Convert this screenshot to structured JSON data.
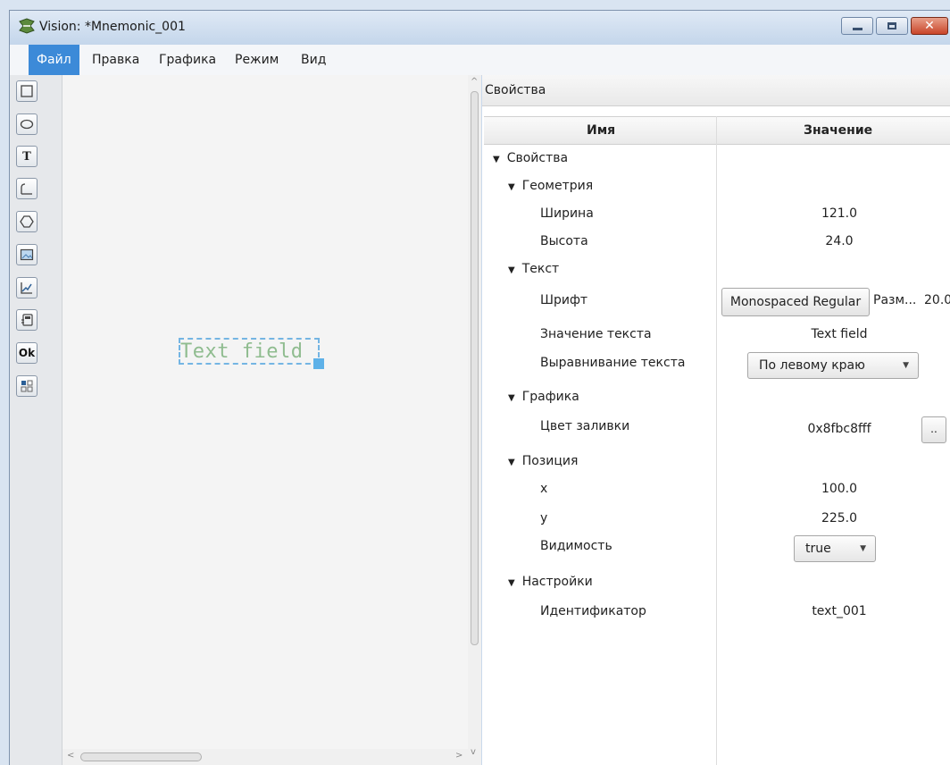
{
  "window": {
    "title": "Vision: *Mnemonic_001",
    "controls": [
      "minimize-icon",
      "maximize-icon",
      "close-icon"
    ]
  },
  "menu": {
    "items": [
      {
        "label": "Файл",
        "active": true
      },
      {
        "label": "Правка",
        "active": false
      },
      {
        "label": "Графика",
        "active": false
      },
      {
        "label": "Режим",
        "active": false
      },
      {
        "label": "Вид",
        "active": false
      }
    ]
  },
  "toolbar": {
    "tools": [
      "rectangle-icon",
      "ellipse-icon",
      "text-icon",
      "polyline-icon",
      "polygon-icon",
      "image-icon",
      "chart-icon",
      "gauge-icon",
      "button-icon",
      "grid-icon"
    ],
    "text_tool_glyph": "T",
    "button_tool_glyph": "Ok"
  },
  "canvas": {
    "text_element": "Text field",
    "text_color": "#8fbc8f",
    "selection_color": "#74b5e3"
  },
  "properties": {
    "panel_title": "Свойства",
    "col_name": "Имя",
    "col_value": "Значение",
    "root": "Свойства",
    "geometry": "Геометрия",
    "width_label": "Ширина",
    "width_value": "121.0",
    "height_label": "Высота",
    "height_value": "24.0",
    "text_group": "Текст",
    "font_label": "Шрифт",
    "font_value": "Monospaced Regular",
    "font_size_label": "Разм...",
    "font_size_value": "20.0",
    "text_value_label": "Значение текста",
    "text_value": "Text field",
    "align_label": "Выравнивание текста",
    "align_value": "По левому краю",
    "graphics_group": "Графика",
    "fill_label": "Цвет заливки",
    "fill_value": "0x8fbc8fff",
    "fill_button": "..",
    "position_group": "Позиция",
    "x_label": "x",
    "x_value": "100.0",
    "y_label": "y",
    "y_value": "225.0",
    "visibility_label": "Видимость",
    "visibility_value": "true",
    "settings_group": "Настройки",
    "id_label": "Идентификатор",
    "id_value": "text_001"
  }
}
